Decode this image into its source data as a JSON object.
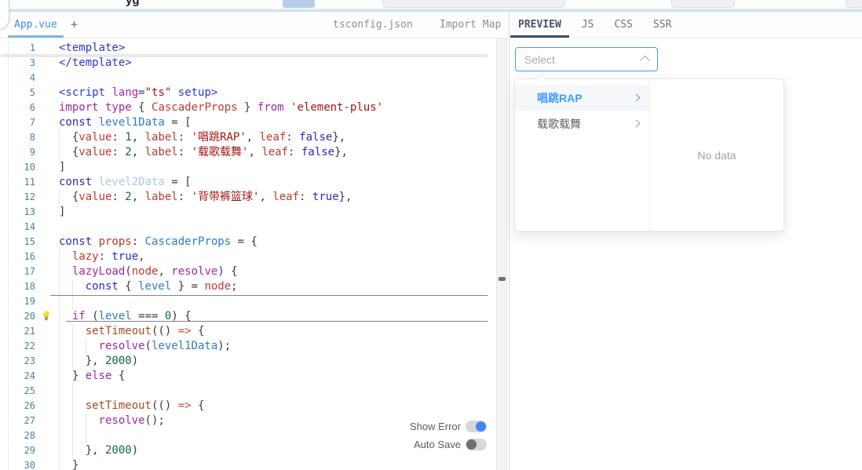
{
  "colors": {
    "accent_blue": "#409EFF",
    "file_tab_blue": "#3F8CE8",
    "preview_underline": "#3D4E6E",
    "toggle_on": "#4285F4",
    "toggle_off": "#6E6E73",
    "string_red": "#A31515",
    "keyword_magenta": "#A626A4",
    "number_green": "#116644"
  },
  "header": {
    "title_fragment": "yg"
  },
  "left_tabs": {
    "active_tab": "App.vue",
    "add_button": "+",
    "right_labels": [
      "tsconfig.json",
      "Import Map"
    ]
  },
  "right_tabs": {
    "tabs": [
      "PREVIEW",
      "JS",
      "CSS",
      "SSR"
    ],
    "active": "PREVIEW"
  },
  "editor": {
    "lines": [
      {
        "n": 1,
        "i": 0,
        "t": [
          [
            "tag",
            "<template>"
          ]
        ]
      },
      {
        "n": 3,
        "i": 0,
        "t": [
          [
            "tag",
            "</template>"
          ]
        ]
      },
      {
        "n": 4,
        "i": 0,
        "t": []
      },
      {
        "n": 5,
        "i": 0,
        "t": [
          [
            "tag",
            "<script "
          ],
          [
            "kw",
            "lang"
          ],
          [
            "b",
            "="
          ],
          [
            "str",
            "\"ts\""
          ],
          [
            "b",
            " "
          ],
          [
            "tag",
            "setup>"
          ]
        ]
      },
      {
        "n": 6,
        "i": 0,
        "t": [
          [
            "kw",
            "import type "
          ],
          [
            "b",
            "{ "
          ],
          [
            "prop",
            "CascaderProps"
          ],
          [
            "b",
            " } "
          ],
          [
            "kw",
            "from"
          ],
          [
            "b",
            " "
          ],
          [
            "str",
            "'element-plus'"
          ]
        ]
      },
      {
        "n": 7,
        "i": 0,
        "t": [
          [
            "blu",
            "const "
          ],
          [
            "def",
            "level1Data"
          ],
          [
            "b",
            " = ["
          ]
        ]
      },
      {
        "n": 8,
        "i": 2,
        "t": [
          [
            "b",
            "{"
          ],
          [
            "prop",
            "value"
          ],
          [
            "b",
            ": "
          ],
          [
            "num",
            "1"
          ],
          [
            "b",
            ", "
          ],
          [
            "prop",
            "label"
          ],
          [
            "b",
            ": "
          ],
          [
            "str",
            "'唱跳RAP'"
          ],
          [
            "b",
            ", "
          ],
          [
            "prop",
            "leaf"
          ],
          [
            "b",
            ": "
          ],
          [
            "blu",
            "false"
          ],
          [
            "b",
            "},"
          ]
        ]
      },
      {
        "n": 9,
        "i": 2,
        "t": [
          [
            "b",
            "{"
          ],
          [
            "prop",
            "value"
          ],
          [
            "b",
            ": "
          ],
          [
            "num",
            "2"
          ],
          [
            "b",
            ", "
          ],
          [
            "prop",
            "label"
          ],
          [
            "b",
            ": "
          ],
          [
            "str",
            "'载歌载舞'"
          ],
          [
            "b",
            ", "
          ],
          [
            "prop",
            "leaf"
          ],
          [
            "b",
            ": "
          ],
          [
            "blu",
            "false"
          ],
          [
            "b",
            "},"
          ]
        ]
      },
      {
        "n": 10,
        "i": 0,
        "t": [
          [
            "b",
            "]"
          ]
        ]
      },
      {
        "n": 11,
        "i": 0,
        "t": [
          [
            "blu",
            "const "
          ],
          [
            "dim",
            "level2Data"
          ],
          [
            "b",
            " = ["
          ]
        ]
      },
      {
        "n": 12,
        "i": 2,
        "t": [
          [
            "b",
            "{"
          ],
          [
            "prop",
            "value"
          ],
          [
            "b",
            ": "
          ],
          [
            "num",
            "2"
          ],
          [
            "b",
            ", "
          ],
          [
            "prop",
            "label"
          ],
          [
            "b",
            ": "
          ],
          [
            "str",
            "'背带裤篮球'"
          ],
          [
            "b",
            ", "
          ],
          [
            "prop",
            "leaf"
          ],
          [
            "b",
            ": "
          ],
          [
            "blu",
            "true"
          ],
          [
            "b",
            "},"
          ]
        ]
      },
      {
        "n": 13,
        "i": 0,
        "t": [
          [
            "b",
            "]"
          ]
        ]
      },
      {
        "n": 14,
        "i": 0,
        "t": []
      },
      {
        "n": 15,
        "i": 0,
        "t": [
          [
            "blu",
            "const "
          ],
          [
            "prop",
            "props"
          ],
          [
            "b",
            ": "
          ],
          [
            "def",
            "CascaderProps"
          ],
          [
            "b",
            " = {"
          ]
        ]
      },
      {
        "n": 16,
        "i": 2,
        "t": [
          [
            "prop",
            "lazy"
          ],
          [
            "b",
            ": "
          ],
          [
            "blu",
            "true"
          ],
          [
            "b",
            ","
          ]
        ]
      },
      {
        "n": 17,
        "i": 2,
        "t": [
          [
            "kw",
            "lazyLoad"
          ],
          [
            "b",
            "("
          ],
          [
            "prop",
            "node"
          ],
          [
            "b",
            ", "
          ],
          [
            "kw",
            "resolve"
          ],
          [
            "b",
            ") {"
          ]
        ]
      },
      {
        "n": 18,
        "i": 4,
        "t": [
          [
            "blu",
            "const "
          ],
          [
            "b",
            "{ "
          ],
          [
            "def",
            "level"
          ],
          [
            "b",
            " } = "
          ],
          [
            "prop",
            "node"
          ],
          [
            "b",
            ";"
          ]
        ]
      },
      {
        "n": 19,
        "i": 4,
        "t": []
      },
      {
        "n": 20,
        "i": 2,
        "bulb": true,
        "t": [
          [
            "kw",
            "if"
          ],
          [
            "b",
            " ("
          ],
          [
            "def",
            "level"
          ],
          [
            "b",
            " === "
          ],
          [
            "num",
            "0"
          ],
          [
            "b",
            ") {"
          ]
        ]
      },
      {
        "n": 21,
        "i": 4,
        "t": [
          [
            "fn",
            "setTimeout"
          ],
          [
            "b",
            "(() "
          ],
          [
            "arw",
            "=>"
          ],
          [
            "b",
            " {"
          ]
        ]
      },
      {
        "n": 22,
        "i": 6,
        "t": [
          [
            "kw",
            "resolve"
          ],
          [
            "b",
            "("
          ],
          [
            "def",
            "level1Data"
          ],
          [
            "b",
            ");"
          ]
        ]
      },
      {
        "n": 23,
        "i": 4,
        "t": [
          [
            "b",
            "}, "
          ],
          [
            "num",
            "2000"
          ],
          [
            "b",
            ")"
          ]
        ]
      },
      {
        "n": 24,
        "i": 2,
        "t": [
          [
            "b",
            "} "
          ],
          [
            "kw",
            "else"
          ],
          [
            "b",
            " {"
          ]
        ]
      },
      {
        "n": 25,
        "i": 4,
        "t": []
      },
      {
        "n": 26,
        "i": 4,
        "t": [
          [
            "fn",
            "setTimeout"
          ],
          [
            "b",
            "(() "
          ],
          [
            "arw",
            "=>"
          ],
          [
            "b",
            " {"
          ]
        ]
      },
      {
        "n": 27,
        "i": 6,
        "t": [
          [
            "kw",
            "resolve"
          ],
          [
            "b",
            "();"
          ]
        ]
      },
      {
        "n": 28,
        "i": 6,
        "t": []
      },
      {
        "n": 29,
        "i": 4,
        "t": [
          [
            "b",
            "}, "
          ],
          [
            "num",
            "2000"
          ],
          [
            "b",
            ")"
          ]
        ]
      },
      {
        "n": 30,
        "i": 2,
        "t": [
          [
            "b",
            "}"
          ]
        ]
      }
    ]
  },
  "overlay_toggles": [
    {
      "label": "Show Error",
      "on": true
    },
    {
      "label": "Auto Save",
      "on": false
    }
  ],
  "preview": {
    "select_placeholder": "Select",
    "cascader_menu": [
      {
        "label": "唱跳RAP",
        "active": true
      },
      {
        "label": "载歌载舞",
        "active": false
      }
    ],
    "empty_text": "No data"
  }
}
